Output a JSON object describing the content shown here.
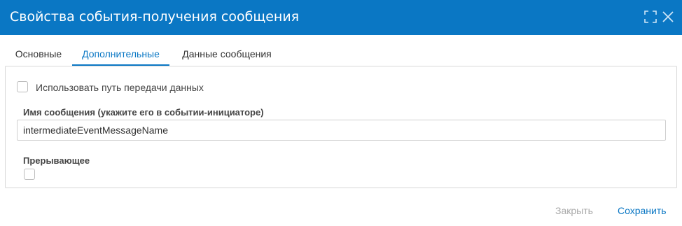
{
  "dialog": {
    "title": "Свойства события-получения сообщения"
  },
  "icons": {
    "expand": "expand-icon",
    "close": "close-icon"
  },
  "tabs": [
    {
      "label": "Основные",
      "active": false
    },
    {
      "label": "Дополнительные",
      "active": true
    },
    {
      "label": "Данные сообщения",
      "active": false
    }
  ],
  "form": {
    "use_data_path": {
      "label": "Использовать путь передачи данных",
      "checked": false
    },
    "message_name": {
      "label": "Имя сообщения (укажите его в событии-инициаторе)",
      "value": "intermediateEventMessageName"
    },
    "interrupting": {
      "label": "Прерывающее",
      "checked": false
    }
  },
  "footer": {
    "close_label": "Закрыть",
    "save_label": "Сохранить"
  },
  "colors": {
    "accent": "#0a77c4",
    "disabled_text": "#a9a9a9"
  }
}
